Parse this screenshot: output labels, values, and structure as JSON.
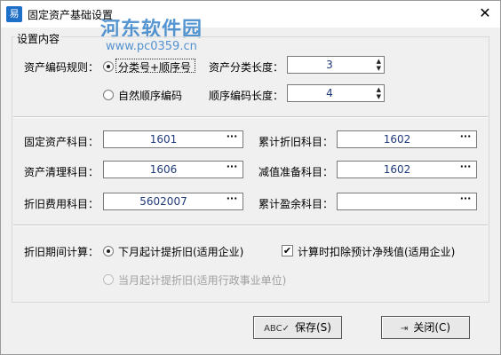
{
  "window": {
    "title": "固定资产基础设置",
    "app_icon": "易",
    "close_glyph": "✕"
  },
  "watermark": {
    "line1": "河东软件园",
    "line2": "www.pc0359.cn"
  },
  "group": {
    "legend": "设置内容"
  },
  "coding": {
    "rule_label": "资产编码规则：",
    "opt1": "分类号+顺序号",
    "opt2": "自然顺序编码",
    "cat_len_label": "资产分类长度：",
    "cat_len_value": "3",
    "seq_len_label": "顺序编码长度：",
    "seq_len_value": "4"
  },
  "accounts": {
    "fixed_label": "固定资产科目：",
    "fixed_value": "1601",
    "accum_label": "累计折旧科目：",
    "accum_value": "1602",
    "clear_label": "资产清理科目：",
    "clear_value": "1606",
    "impair_label": "减值准备科目：",
    "impair_value": "1602",
    "expense_label": "折旧费用科目：",
    "expense_value": "5602007",
    "surplus_label": "累计盈余科目：",
    "surplus_value": ""
  },
  "depr": {
    "period_label": "折旧期间计算：",
    "opt_next": "下月起计提折旧(适用企业)",
    "opt_current": "当月起计提折旧(适用行政事业单位)",
    "deduct_label": "计算时扣除预计净残值(适用企业)",
    "deduct_checked": "✔"
  },
  "buttons": {
    "save_label": "保存(S)",
    "close_label": "关闭(C)"
  },
  "icons": {
    "spin_up": "▲",
    "spin_down": "▼",
    "ellipsis": "···",
    "save_icon": "ABC✓",
    "exit_icon": "⇥"
  }
}
